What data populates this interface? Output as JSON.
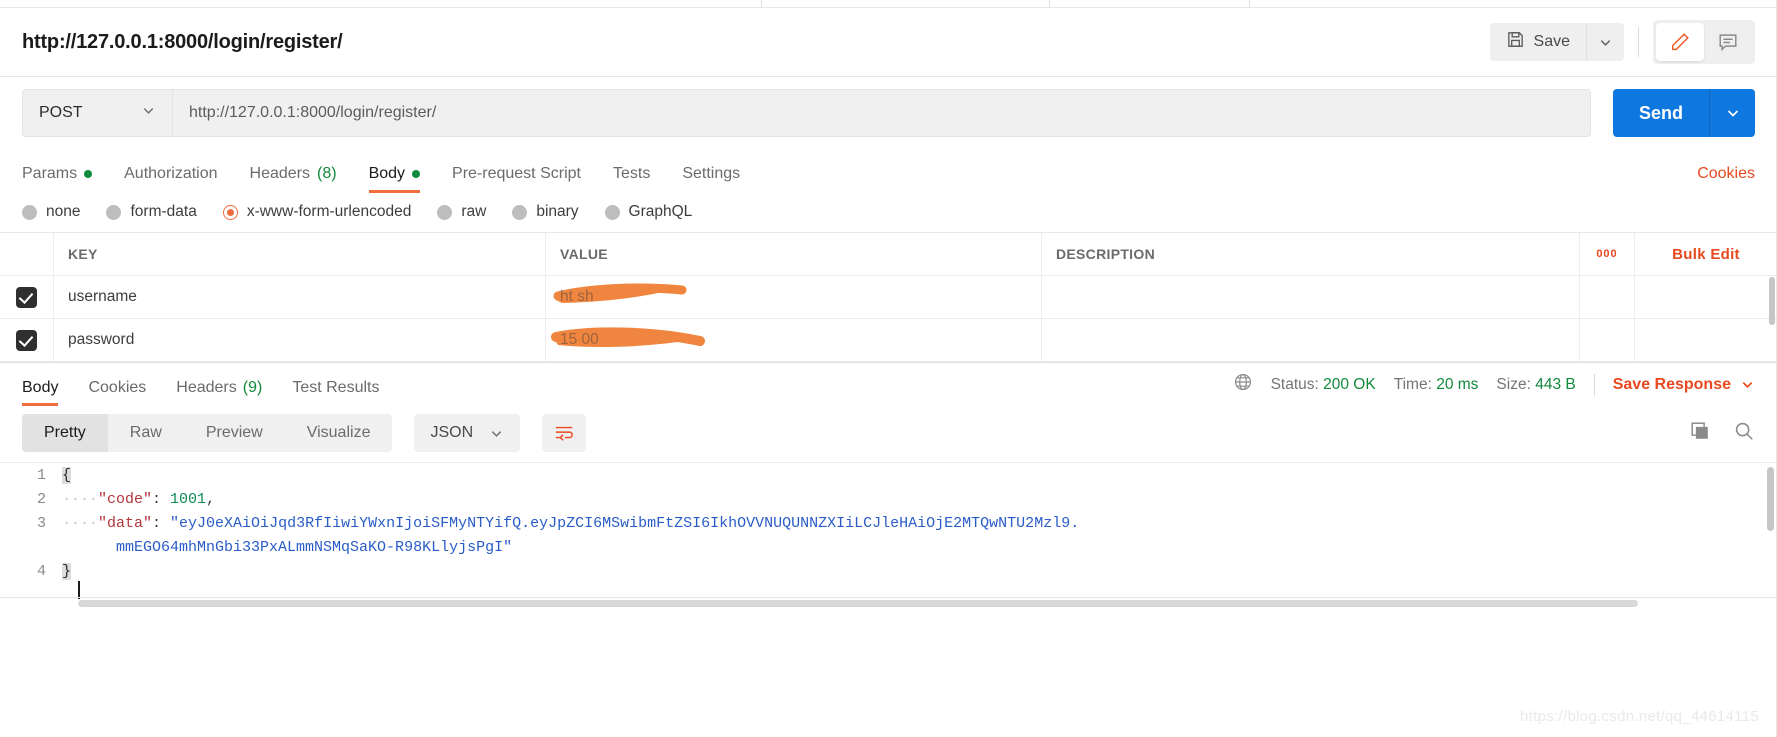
{
  "request": {
    "title": "http://127.0.0.1:8000/login/register/",
    "method": "POST",
    "url": "http://127.0.0.1:8000/login/register/",
    "save_label": "Save",
    "send_label": "Send"
  },
  "request_tabs": [
    {
      "label": "Params",
      "dot": true,
      "count": null,
      "active": false
    },
    {
      "label": "Authorization",
      "dot": false,
      "count": null,
      "active": false
    },
    {
      "label": "Headers",
      "dot": false,
      "count": "(8)",
      "active": false
    },
    {
      "label": "Body",
      "dot": true,
      "count": null,
      "active": true
    },
    {
      "label": "Pre-request Script",
      "dot": false,
      "count": null,
      "active": false
    },
    {
      "label": "Tests",
      "dot": false,
      "count": null,
      "active": false
    },
    {
      "label": "Settings",
      "dot": false,
      "count": null,
      "active": false
    }
  ],
  "cookies_link": "Cookies",
  "body_types": [
    {
      "label": "none",
      "selected": false
    },
    {
      "label": "form-data",
      "selected": false
    },
    {
      "label": "x-www-form-urlencoded",
      "selected": true
    },
    {
      "label": "raw",
      "selected": false
    },
    {
      "label": "binary",
      "selected": false
    },
    {
      "label": "GraphQL",
      "selected": false
    }
  ],
  "kv_table": {
    "headers": {
      "key": "KEY",
      "value": "VALUE",
      "description": "DESCRIPTION"
    },
    "dots_label": "000",
    "bulk_edit_label": "Bulk Edit",
    "rows": [
      {
        "checked": true,
        "key": "username",
        "value": "",
        "value_redacted": true,
        "description": ""
      },
      {
        "checked": true,
        "key": "password",
        "value": "",
        "value_redacted": true,
        "description": ""
      }
    ]
  },
  "response_tabs": [
    {
      "label": "Body",
      "count": null,
      "active": true
    },
    {
      "label": "Cookies",
      "count": null,
      "active": false
    },
    {
      "label": "Headers",
      "count": "(9)",
      "active": false
    },
    {
      "label": "Test Results",
      "count": null,
      "active": false
    }
  ],
  "response_status": {
    "status_label": "Status:",
    "status_value": "200 OK",
    "time_label": "Time:",
    "time_value": "20 ms",
    "size_label": "Size:",
    "size_value": "443 B",
    "save_response_label": "Save Response"
  },
  "response_toolbar": {
    "views": [
      {
        "label": "Pretty",
        "active": true
      },
      {
        "label": "Raw",
        "active": false
      },
      {
        "label": "Preview",
        "active": false
      },
      {
        "label": "Visualize",
        "active": false
      }
    ],
    "format": "JSON"
  },
  "response_body": {
    "lines": [
      {
        "num": "1",
        "indent": "",
        "segments": [
          {
            "t": "{",
            "c": "brace-hl"
          }
        ]
      },
      {
        "num": "2",
        "indent": "····",
        "segments": [
          {
            "t": "\"code\"",
            "c": "k-key"
          },
          {
            "t": ": ",
            "c": "k-punc"
          },
          {
            "t": "1001",
            "c": "k-num"
          },
          {
            "t": ",",
            "c": "k-punc"
          }
        ]
      },
      {
        "num": "3",
        "indent": "····",
        "segments": [
          {
            "t": "\"data\"",
            "c": "k-key"
          },
          {
            "t": ": ",
            "c": "k-punc"
          },
          {
            "t": "\"eyJ0eXAiOiJqd3RfIiwiYWxnIjoiSFMyNTYifQ.eyJpZCI6MSwibmFtZSI6IkhOVVNUQUNNZXIiLCJleHAiOjE2MTQwNTU2Mzl9.",
            "c": "k-str"
          }
        ]
      },
      {
        "num": "",
        "indent": "      ",
        "segments": [
          {
            "t": "mmEGO64mhMnGbi33PxALmmNSMqSaKO-R98KLlyjsPgI\"",
            "c": "k-str"
          }
        ]
      },
      {
        "num": "4",
        "indent": "",
        "segments": [
          {
            "t": "}",
            "c": "brace-hl"
          }
        ]
      }
    ]
  },
  "watermark": "https://blog.csdn.net/qq_44614115",
  "colors": {
    "accent_orange": "#f26d3d",
    "link_orange": "#e8491f",
    "send_blue": "#0f77e0",
    "status_green": "#11893c",
    "string_blue": "#2a5cc8",
    "key_red": "#b5353b"
  }
}
